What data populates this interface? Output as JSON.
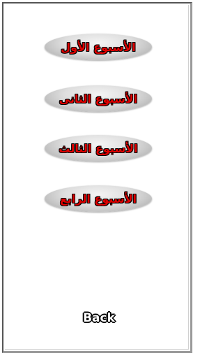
{
  "weeks": [
    {
      "label": "الأسبوع الأول"
    },
    {
      "label": "الأسبوع الثانى"
    },
    {
      "label": "الأسبوع الثالث"
    },
    {
      "label": "الأسبوع الرابع"
    }
  ],
  "back": {
    "label": "Back"
  },
  "colors": {
    "label_red": "#e00000",
    "button_grey": "#dedede",
    "background": "#ffffff"
  }
}
